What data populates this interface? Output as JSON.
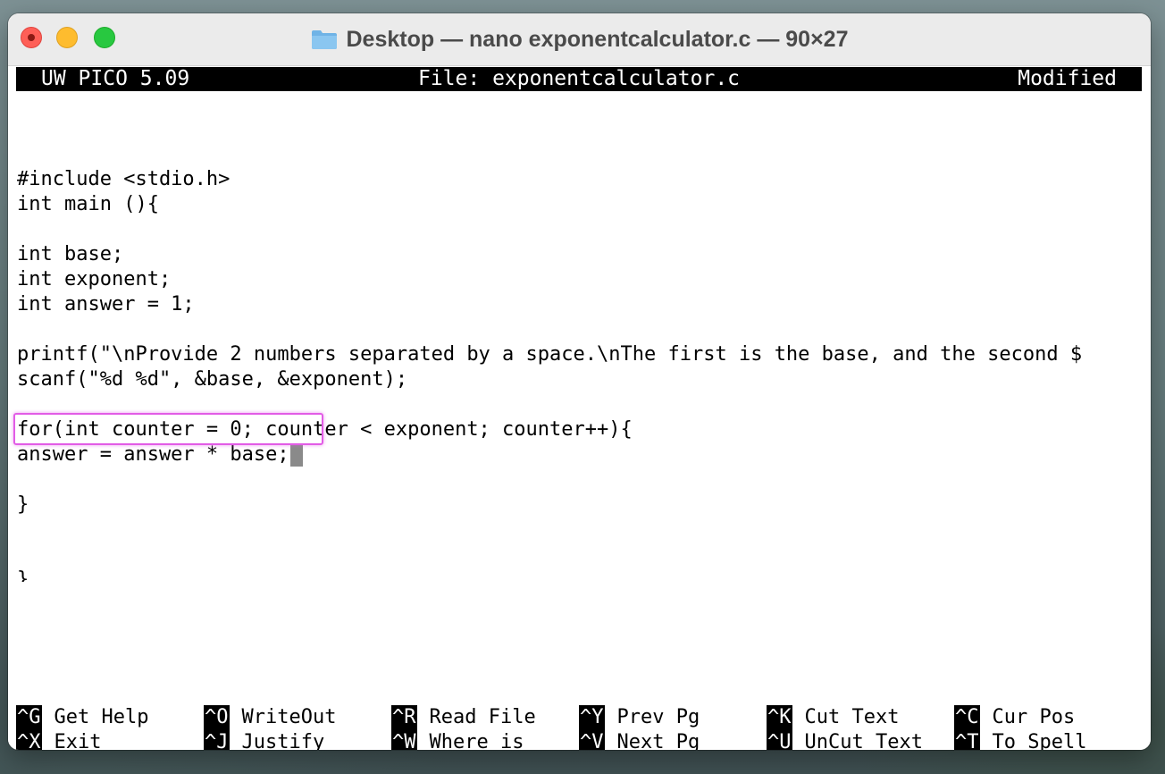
{
  "window": {
    "title": "Desktop — nano exponentcalculator.c — 90×27"
  },
  "editor": {
    "app_name": "UW PICO 5.09",
    "file_label": "File: exponentcalculator.c",
    "status": "Modified",
    "lines": [
      "",
      "",
      "#include <stdio.h>",
      "int main (){",
      "",
      "int base;",
      "int exponent;",
      "int answer = 1;",
      "",
      "printf(\"\\nProvide 2 numbers separated by a space.\\nThe first is the base, and the second $",
      "scanf(\"%d %d\", &base, &exponent);",
      "",
      "for(int counter = 0; counter < exponent; counter++){",
      "answer = answer * base;",
      "",
      "}",
      "",
      "",
      "}"
    ],
    "cursor_line_index": 13
  },
  "shortcuts": [
    {
      "key": "^G",
      "label": "Get Help"
    },
    {
      "key": "^O",
      "label": "WriteOut"
    },
    {
      "key": "^R",
      "label": "Read File"
    },
    {
      "key": "^Y",
      "label": "Prev Pg"
    },
    {
      "key": "^K",
      "label": "Cut Text"
    },
    {
      "key": "^C",
      "label": "Cur Pos"
    },
    {
      "key": "^X",
      "label": "Exit"
    },
    {
      "key": "^J",
      "label": "Justify"
    },
    {
      "key": "^W",
      "label": "Where is"
    },
    {
      "key": "^V",
      "label": "Next Pg"
    },
    {
      "key": "^U",
      "label": "UnCut Text"
    },
    {
      "key": "^T",
      "label": "To Spell"
    }
  ],
  "colors": {
    "highlight": "#e25ce6",
    "close": "#fe5f57",
    "minimize": "#febc2e",
    "maximize": "#28c840"
  }
}
